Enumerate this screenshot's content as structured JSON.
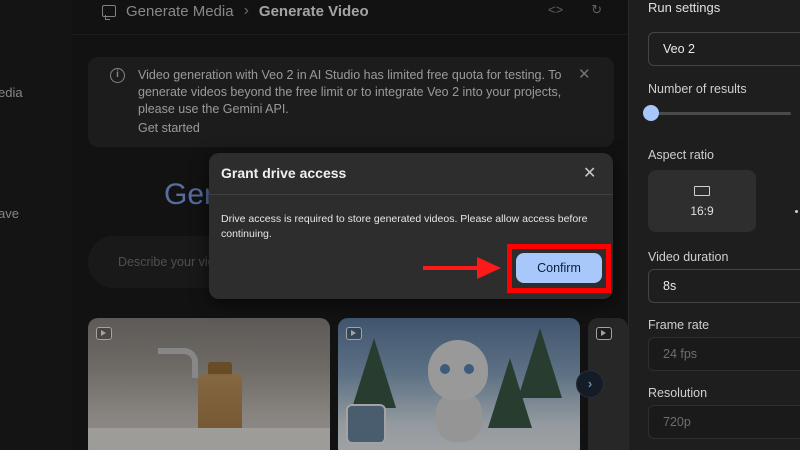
{
  "leftnav": {
    "items": [
      "edia",
      "ave"
    ]
  },
  "breadcrumb": {
    "parent": "Generate Media",
    "separator": "›",
    "current": "Generate Video",
    "icons": [
      "code-icon",
      "refresh-icon"
    ]
  },
  "banner": {
    "text": "Video generation with Veo 2 in AI Studio has limited free quota for testing. To generate videos beyond the free limit or to integrate Veo 2 into your projects, please use the Gemini API.",
    "link": "Get started",
    "close": "✕",
    "info": "i"
  },
  "hero": {
    "title": "Gen"
  },
  "prompt": {
    "placeholder": "Describe your vic"
  },
  "gallery": {
    "next": "›"
  },
  "dialog": {
    "title": "Grant drive access",
    "close": "✕",
    "body": "Drive access is required to store generated videos. Please allow access before continuing.",
    "confirm": "Confirm"
  },
  "run_settings": {
    "title": "Run settings",
    "model": "Veo 2",
    "number_of_results_label": "Number of results",
    "number_of_results_fraction": 0.0,
    "aspect_ratio_label": "Aspect ratio",
    "aspect_ratio": "16:9",
    "video_duration_label": "Video duration",
    "video_duration": "8s",
    "frame_rate_label": "Frame rate",
    "frame_rate": "24 fps",
    "resolution_label": "Resolution",
    "resolution": "720p"
  },
  "colors": {
    "accent": "#a8c7fa",
    "highlight": "#ff0000",
    "hero": "#7fa1e8"
  }
}
